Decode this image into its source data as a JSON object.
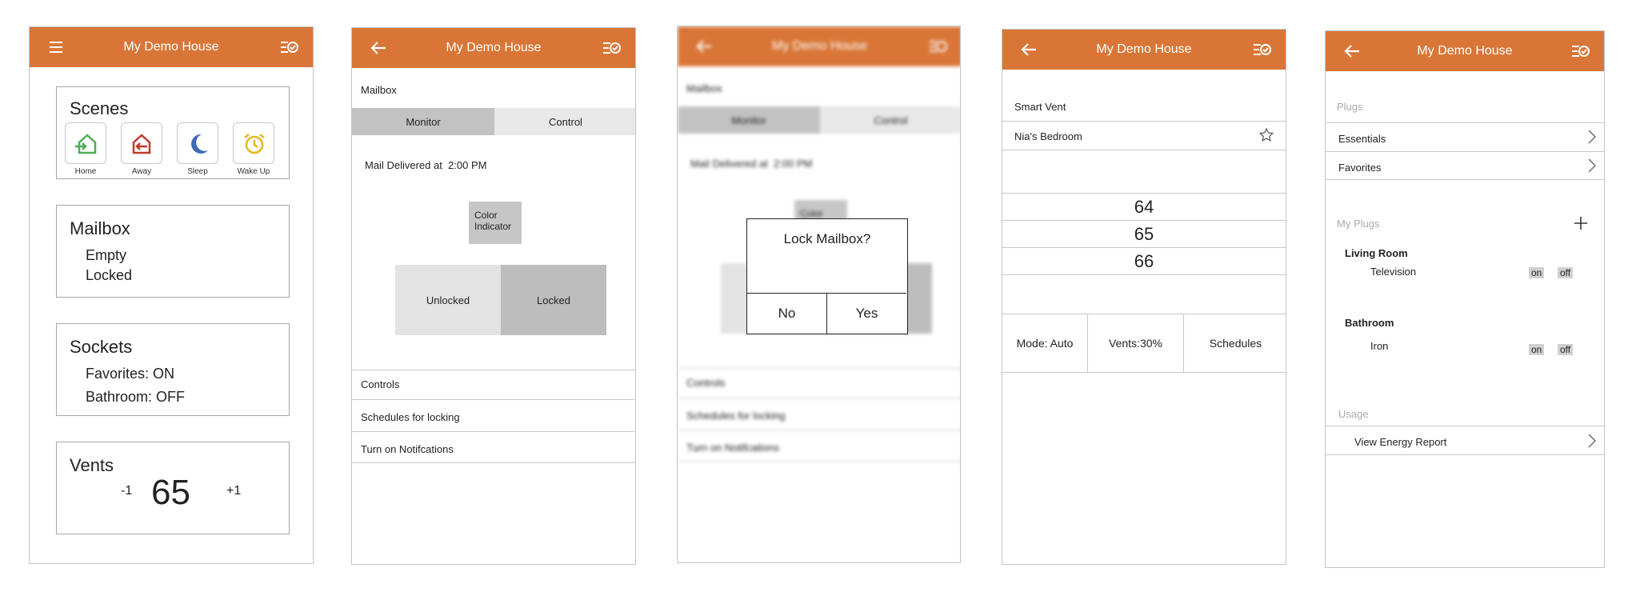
{
  "app": {
    "title": "My Demo House"
  },
  "home": {
    "scenes": {
      "title": "Scenes",
      "items": [
        {
          "label": "Home",
          "icon": "home-arrive-icon",
          "color": "#4caf50"
        },
        {
          "label": "Away",
          "icon": "home-leave-icon",
          "color": "#c0392b"
        },
        {
          "label": "Sleep",
          "icon": "moon-icon",
          "color": "#3f6bb5"
        },
        {
          "label": "Wake Up",
          "icon": "alarm-clock-icon",
          "color": "#e6b81e"
        }
      ]
    },
    "mailbox": {
      "title": "Mailbox",
      "line1": "Empty",
      "line2": "Locked"
    },
    "sockets": {
      "title": "Sockets",
      "line1": "Favorites: ON",
      "line2": "Bathroom: OFF"
    },
    "vents": {
      "title": "Vents",
      "minus": "-1",
      "value": "65",
      "plus": "+1"
    }
  },
  "mailbox_screen": {
    "heading": "Mailbox",
    "tabs": {
      "monitor": "Monitor",
      "control": "Control"
    },
    "delivered": "Mail Delivered at  2:00 PM",
    "indicator": "Color Indicator",
    "unlocked": "Unlocked",
    "locked": "Locked",
    "rows": [
      "Controls",
      "Schedules for locking",
      "Turn on Notifcations"
    ]
  },
  "dialog": {
    "title": "Lock Mailbox?",
    "no": "No",
    "yes": "Yes",
    "behind_indicator": "Color"
  },
  "vent_screen": {
    "heading": "Smart Vent",
    "room": "Nia's Bedroom",
    "temps": [
      "64",
      "65",
      "66"
    ],
    "mode": "Mode: Auto",
    "vents": "Vents:30%",
    "schedules": "Schedules"
  },
  "plugs_screen": {
    "plugs_header": "Plugs",
    "essentials": "Essentials",
    "favorites": "Favorites",
    "my_plugs": "My Plugs",
    "living_room": "Living Room",
    "television": "Television",
    "bathroom": "Bathroom",
    "iron": "Iron",
    "on": "on",
    "off": "off",
    "usage": "Usage",
    "energy": "View Energy Report"
  },
  "colors": {
    "accent": "#d97637"
  }
}
